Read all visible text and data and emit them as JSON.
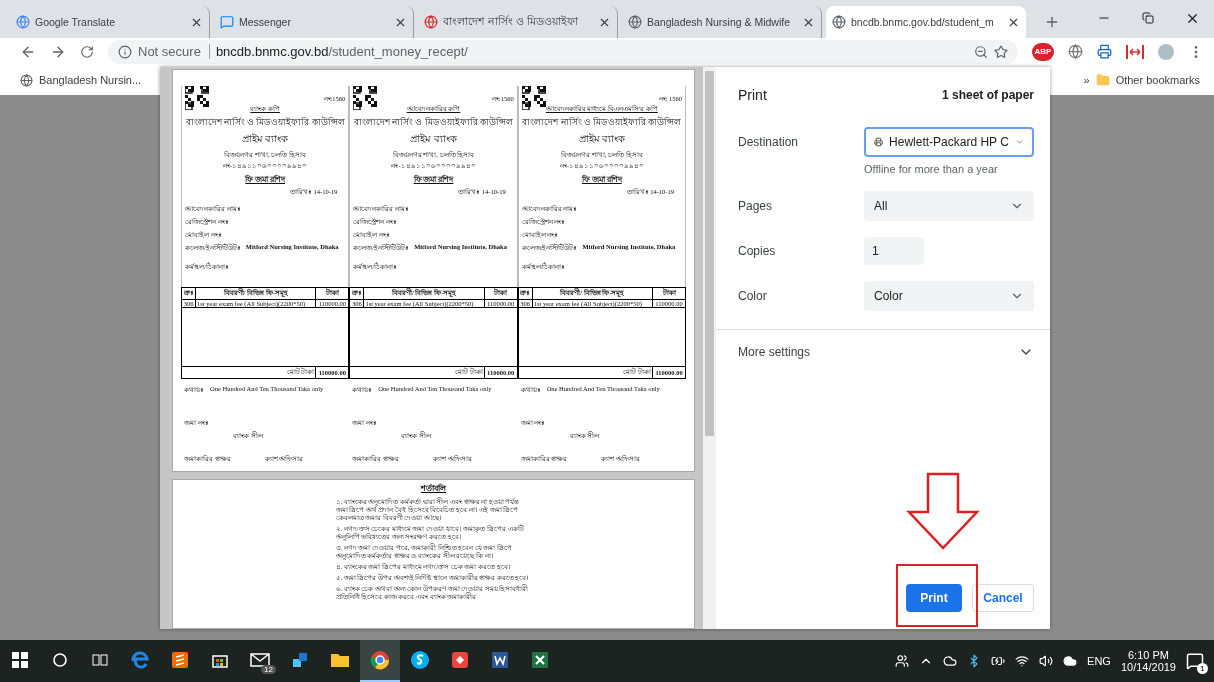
{
  "browser": {
    "tabs": [
      {
        "title": "Google Translate",
        "selected": false
      },
      {
        "title": "Messenger",
        "selected": false
      },
      {
        "title": "বাংলাদেশ নার্সিং ও মিডওয়াইফা",
        "selected": false
      },
      {
        "title": "Bangladesh Nursing & Midwife",
        "selected": false
      },
      {
        "title": "bncdb.bnmc.gov.bd/student_m",
        "selected": true
      }
    ],
    "address": {
      "security": "Not secure",
      "host": "bncdb.bnmc.gov.bd",
      "path": "/student_money_recept/"
    },
    "extension_label": "ABP",
    "bookmarks": [
      {
        "label": "Bangladesh Nursin..."
      }
    ],
    "bookmarks_overflow": "»",
    "other_bookmarks": "Other bookmarks"
  },
  "preview": {
    "receipts": [
      {
        "copy_label": "ব্যাংক কপি",
        "serial": "নং:1560",
        "council": "বাংলাদেশ নার্সিং ও মিডওয়াইফারি কাউন্সিল",
        "bank": "প্রাইম ব্যাংক",
        "branch": "বিজয়নগর শাখা, চলতি হিসাব নং-১৪৯১১০৬০০০০৯৯৪০",
        "title": "ফি জমা রশিদ",
        "date": "তারিখঃ 14-10-19",
        "fields": [
          {
            "label": "আবেদনকারির নামঃ"
          },
          {
            "label": "রেজিস্ট্রেশন নংঃ"
          },
          {
            "label": "মোবাইল নংঃ"
          },
          {
            "label": "কলেজ/ইনস্টিটিউটঃ",
            "value": "Mitford Nursing Institute, Dhaka"
          },
          {
            "label": "কর্মস্থল/ঠিকানাঃ"
          }
        ],
        "columns": [
          "ক্রঃ",
          "বিবরণী/ বিভিন্ন ফি-সমূহ",
          "টাকা"
        ],
        "rows": [
          [
            "306",
            "1st year exam fee (All Subject)(2200*50)",
            "110000.00"
          ]
        ],
        "total_label": "মোট টাকা",
        "total": "110000.00",
        "words_label": "কথায়ঃ",
        "words": "One Hundred And Ten Thousand Taka only",
        "deposit_label": "জমা নংঃ",
        "seal": "ব্যাংক সীল",
        "depositor_sign": "জমাকারির স্বাক্ষর",
        "officer": "ক্যাশ অফিসার"
      },
      {
        "copy_label": "আবেদনকারির কপি",
        "serial": "নং:1560",
        "council": "বাংলাদেশ নার্সিং ও মিডওয়াইফারি কাউন্সিল",
        "bank": "প্রাইম ব্যাংক",
        "branch": "বিজয়নগর শাখা, চলতি হিসাব নং-১৪৯১১০৬০০০০৯৯৪০",
        "title": "ফি জমা রশিদ",
        "date": "তারিখঃ 14-10-19",
        "fields": [
          {
            "label": "আবেদনকারির নামঃ"
          },
          {
            "label": "রেজিস্ট্রেশন নংঃ"
          },
          {
            "label": "মোবাইল নংঃ"
          },
          {
            "label": "কলেজ/ইনস্টিটিউটঃ",
            "value": "Mitford Nursing Institute, Dhaka"
          },
          {
            "label": "কর্মস্থল/ঠিকানাঃ"
          }
        ],
        "columns": [
          "ক্রঃ",
          "বিবরণী/ বিভিন্ন ফি-সমূহ",
          "টাকা"
        ],
        "rows": [
          [
            "306",
            "1st year exam fee (All Subject)(2200*50)",
            "110000.00"
          ]
        ],
        "total_label": "মোট টাকা",
        "total": "110000.00",
        "words_label": "কথায়ঃ",
        "words": "One Hundred And Ten Thousand Taka only",
        "deposit_label": "জমা নংঃ",
        "seal": "ব্যাংক সীল",
        "depositor_sign": "জমাকারির স্বাক্ষর",
        "officer": "ক্যাশ অফিসার"
      },
      {
        "copy_label": "আবেদনকারির মাধ্যমে বিএনএমসি'র কপি",
        "serial": "নং: 1560",
        "council": "বাংলাদেশ নার্সিং ও মিডওয়াইফারি কাউন্সিল",
        "bank": "প্রাইম ব্যাংক",
        "branch": "বিজয়নগর শাখা, চলতি হিসাব নং-১৪৯১১০৬০০০০৯৯৪০",
        "title": "ফি জমা রশিদ",
        "date": "তারিখঃ 14-10-19",
        "fields": [
          {
            "label": "আবেদনকারির নামঃ"
          },
          {
            "label": "রেজিস্ট্রেশন নংঃ"
          },
          {
            "label": "মোবাইল নংঃ"
          },
          {
            "label": "কলেজ/ইনস্টিটিউটঃ",
            "value": "Mitford Nursing Institute, Dhaka"
          },
          {
            "label": "কর্মস্থল/ঠিকানাঃ"
          }
        ],
        "columns": [
          "ক্রঃ",
          "বিবরণী/ বিভিন্ন ফি-সমূহ",
          "টাকা"
        ],
        "rows": [
          [
            "306",
            "1st year exam fee (All Subject)(2200*50)",
            "110000.00"
          ]
        ],
        "total_label": "মোট টাকা",
        "total": "110000.00",
        "words_label": "কথায়ঃ",
        "words": "One Hundred And Ten Thousand Taka only",
        "deposit_label": "জমা নংঃ",
        "seal": "ব্যাংক সীল",
        "depositor_sign": "জমাকারির স্বাক্ষর",
        "officer": "ক্যাশ অফিসার"
      }
    ],
    "terms": {
      "title": "শর্তাবলি",
      "items": [
        "১. ব্যাংকের অনুমোদিত কর্মকর্তা দ্বারা সীল এবং স্বাক্ষর না হওয়া পর্যন্ত জমা স্লিপে অর্থ প্রদান বৈধ হিসেবে বিবেচিত হবে না। এই জমা স্লিপে কেবলমাত্র জমার বিবরণী দেওয়া আছে।",
        "২. নগদ/ক্রস চেকের মাধ্যমে জমা দেওয়া যাবে। জমাকৃত স্লিপের একটি অনুলিপি ভবিষ্যতের জন্য সংরক্ষণ করতে হবে।",
        "৩. নগদ জমা দেওয়ার পরে, জমাকারী নিশ্চিত হবেন যে জমা স্লিপে অনুমোদিত কর্মকর্তার স্বাক্ষর ও ব্যাংকের সীল রয়েছে কি না।",
        "৪. ব্যাংকের জমা স্লিপের মাধ্যমে নগদ/ক্রস চেক জমা করতে হবে।",
        "৫. জমা স্লিপের উপর অবশ্যই নির্দিষ্ট স্থানে জমাকারীর স্বাক্ষর করতে হবে।",
        "৬. ব্যাংক চেক অথবা অন্য কোন উপকরণ জমা দেওয়ার সময় হিসাবধারী প্রতিনিধি হিসেবে কাজ করবে এবং ব্যাংক জমাকারীর"
      ]
    }
  },
  "print_panel": {
    "title": "Print",
    "sheets": "1 sheet of paper",
    "settings": [
      {
        "kind": "destination",
        "label": "Destination",
        "value": "Hewlett-Packard HP C",
        "focused": true,
        "note": "Offline for more than a year"
      },
      {
        "kind": "select",
        "label": "Pages",
        "value": "All",
        "focused": false
      },
      {
        "kind": "input",
        "label": "Copies",
        "value": "1"
      },
      {
        "kind": "select",
        "label": "Color",
        "value": "Color",
        "focused": false
      }
    ],
    "more_settings": {
      "label": "More settings",
      "expanded": false
    },
    "buttons": [
      {
        "kind": "primary",
        "label": "Print"
      },
      {
        "kind": "secondary",
        "label": "Cancel"
      }
    ]
  },
  "taskbar": {
    "apps": [
      {
        "selected": false
      },
      {
        "selected": false
      },
      {
        "selected": false
      },
      {
        "selected": false
      },
      {
        "selected": false
      },
      {
        "selected": false
      },
      {
        "selected": false,
        "badge": "12"
      },
      {
        "selected": false
      },
      {
        "selected": false
      },
      {
        "selected": true
      },
      {
        "selected": false
      },
      {
        "selected": false
      },
      {
        "selected": false
      },
      {
        "selected": false
      }
    ],
    "language": "ENG",
    "time": "6:10 PM",
    "date": "10/14/2019",
    "notifications": "1"
  }
}
